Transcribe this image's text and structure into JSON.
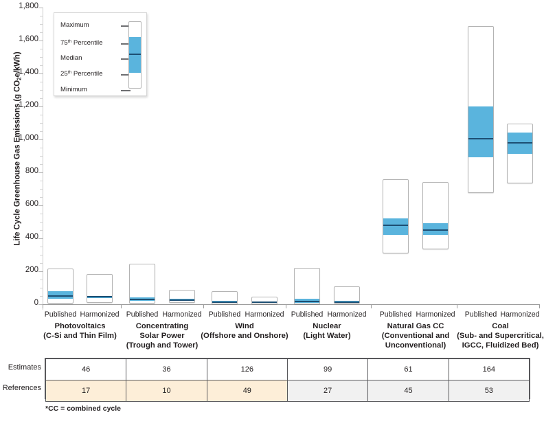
{
  "chart_data": {
    "type": "bar",
    "title": "",
    "xlabel": "",
    "ylabel": "Life Cycle Greenhouse Gas Emissions (g CO2e/kWh)",
    "ylabel_prefix": "Life Cycle Greenhouse Gas Emissions (g CO",
    "ylabel_sub": "2",
    "ylabel_suffix": "e/kWh)",
    "ylim": [
      0,
      1800
    ],
    "ytick_step": 200,
    "yminor_step": 50,
    "grid": false,
    "legend_position": "inside-top-left",
    "ytick_labels": [
      "1,800",
      "1,600",
      "1,400",
      "1,200",
      "1,000",
      "800",
      "600",
      "400",
      "200",
      "0"
    ],
    "ytick_values": [
      1800,
      1600,
      1400,
      1200,
      1000,
      800,
      600,
      400,
      200,
      0
    ],
    "series_labels": [
      "Published",
      "Harmonized"
    ],
    "categories": [
      {
        "name": "Photovoltaics",
        "sub": [
          "(C-Si and Thin Film)"
        ]
      },
      {
        "name": "Concentrating",
        "sub": [
          "Solar Power",
          "(Trough and Tower)"
        ]
      },
      {
        "name": "Wind",
        "sub": [
          "(Offshore and Onshore)"
        ]
      },
      {
        "name": "Nuclear",
        "sub": [
          "(Light Water)"
        ]
      },
      {
        "name": "Natural Gas CC",
        "sub": [
          "(Conventional and",
          "Unconventional)"
        ]
      },
      {
        "name": "Coal",
        "sub": [
          "(Sub- and Supercritical,",
          "IGCC, Fluidized Bed)"
        ]
      }
    ],
    "boxes": [
      {
        "group": "Photovoltaics",
        "series": "Published",
        "min": 5,
        "q1": 34,
        "median": 48,
        "q3": 78,
        "max": 217
      },
      {
        "group": "Photovoltaics",
        "series": "Harmonized",
        "min": 8,
        "q1": 38,
        "median": 44,
        "q3": 50,
        "max": 183
      },
      {
        "group": "Concentrating Solar Power",
        "series": "Published",
        "min": 6,
        "q1": 20,
        "median": 28,
        "q3": 40,
        "max": 245
      },
      {
        "group": "Concentrating Solar Power",
        "series": "Harmonized",
        "min": 7,
        "q1": 20,
        "median": 26,
        "q3": 33,
        "max": 89
      },
      {
        "group": "Wind",
        "series": "Published",
        "min": 2,
        "q1": 9,
        "median": 12,
        "q3": 20,
        "max": 81
      },
      {
        "group": "Wind",
        "series": "Harmonized",
        "min": 2,
        "q1": 8,
        "median": 11,
        "q3": 16,
        "max": 45
      },
      {
        "group": "Nuclear",
        "series": "Published",
        "min": 1,
        "q1": 9,
        "median": 16,
        "q3": 35,
        "max": 220
      },
      {
        "group": "Nuclear",
        "series": "Harmonized",
        "min": 4,
        "q1": 9,
        "median": 12,
        "q3": 20,
        "max": 110
      },
      {
        "group": "Natural Gas CC",
        "series": "Published",
        "min": 307,
        "q1": 422,
        "median": 478,
        "q3": 520,
        "max": 757
      },
      {
        "group": "Natural Gas CC",
        "series": "Harmonized",
        "min": 333,
        "q1": 422,
        "median": 450,
        "q3": 491,
        "max": 742
      },
      {
        "group": "Coal",
        "series": "Published",
        "min": 675,
        "q1": 890,
        "median": 1004,
        "q3": 1199,
        "max": 1689
      },
      {
        "group": "Coal",
        "series": "Harmonized",
        "min": 733,
        "q1": 912,
        "median": 979,
        "q3": 1042,
        "max": 1095
      }
    ]
  },
  "legend": {
    "title": "",
    "items": [
      {
        "label_prefix": "Maximum",
        "label_sup": "",
        "label_suffix": ""
      },
      {
        "label_prefix": "75",
        "label_sup": "th",
        "label_suffix": " Percentile"
      },
      {
        "label_prefix": "Median",
        "label_sup": "",
        "label_suffix": ""
      },
      {
        "label_prefix": "25",
        "label_sup": "th",
        "label_suffix": " Percentile"
      },
      {
        "label_prefix": "Minimum",
        "label_sup": "",
        "label_suffix": ""
      }
    ]
  },
  "table": {
    "row_labels": [
      "Estimates",
      "References"
    ],
    "columns": [
      "Photovoltaics",
      "Concentrating Solar Power",
      "Wind",
      "Nuclear",
      "Natural Gas CC",
      "Coal"
    ],
    "estimates": [
      "46",
      "36",
      "126",
      "99",
      "61",
      "164"
    ],
    "references": [
      "17",
      "10",
      "49",
      "27",
      "45",
      "53"
    ],
    "references_cell_colors": [
      "#fdeed8",
      "#fdeed8",
      "#fdeed8",
      "#f1f1f1",
      "#f1f1f1",
      "#f1f1f1"
    ]
  },
  "footnote": "*CC = combined cycle",
  "colors": {
    "iqr_fill": "#5ab4dd",
    "median_line": "#1d4f73",
    "bar_outline": "#b3b3b3",
    "axis": "#9a9a9a",
    "text": "#231f20",
    "table_border": "#58585b",
    "ref_cream": "#fdeed8",
    "ref_gray": "#f1f1f1"
  }
}
